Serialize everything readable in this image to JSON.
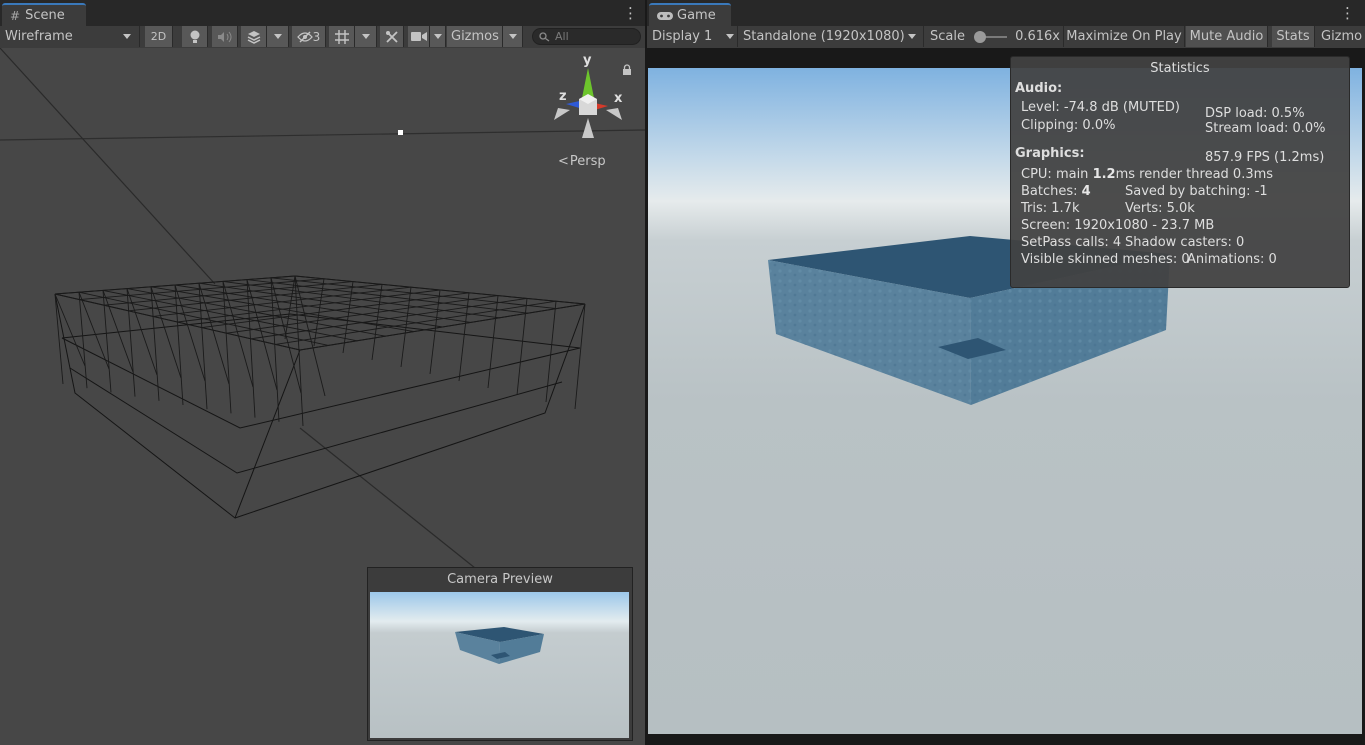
{
  "scene": {
    "tab_label": "Scene",
    "draw_mode": "Wireframe",
    "btn_2d": "2D",
    "hidden_count": "3",
    "gizmos_label": "Gizmos",
    "search_placeholder": "All",
    "axis_y": "y",
    "axis_x": "x",
    "axis_z": "z",
    "projection_label": "Persp",
    "camera_preview_title": "Camera Preview"
  },
  "game": {
    "tab_label": "Game",
    "display": "Display 1",
    "resolution": "Standalone (1920x1080)",
    "scale_label": "Scale",
    "scale_value": "0.616x",
    "maximize_label": "Maximize On Play",
    "mute_label": "Mute Audio",
    "stats_label": "Stats",
    "gizmos_label": "Gizmo"
  },
  "stats": {
    "title": "Statistics",
    "audio_heading": "Audio:",
    "level": "Level: -74.8 dB (MUTED)",
    "clipping": "Clipping: 0.0%",
    "dsp_load": "DSP load: 0.5%",
    "stream_load": "Stream load: 0.0%",
    "graphics_heading": "Graphics:",
    "fps": "857.9 FPS (1.2ms)",
    "cpu_prefix": "CPU: main ",
    "cpu_main": "1.2",
    "cpu_suffix": "ms  render thread 0.3ms",
    "batches_prefix": "Batches: ",
    "batches": "4",
    "saved_batching": "Saved by batching: -1",
    "tris": "Tris: 1.7k",
    "verts": "Verts: 5.0k",
    "screen": "Screen: 1920x1080 - 23.7 MB",
    "setpass": "SetPass calls: 4",
    "shadow_casters": "Shadow casters: 0",
    "skinned": "Visible skinned meshes: 0",
    "animations": "Animations: 0"
  },
  "colors": {
    "accent": "#3a79bb",
    "panel_bg": "#282828",
    "toolbar_bg": "#3c3c3c",
    "button_bg": "#585858",
    "scene_bg": "#474747",
    "cube_top": "#2e5573",
    "cube_side": "#527c98",
    "axis_x": "#d63a2a",
    "axis_y": "#6dc52c",
    "axis_z": "#2f5ad6"
  },
  "icons": {
    "scene_tab": "hash-icon",
    "game_tab": "gamepad-icon",
    "lighting": "light-bulb-icon",
    "audio": "speaker-icon",
    "effects": "layers-icon",
    "visibility": "eye-crossed-icon",
    "grid": "grid-icon",
    "tools": "tools-icon",
    "camera": "camera-icon",
    "search": "search-icon",
    "lock": "lock-icon"
  }
}
